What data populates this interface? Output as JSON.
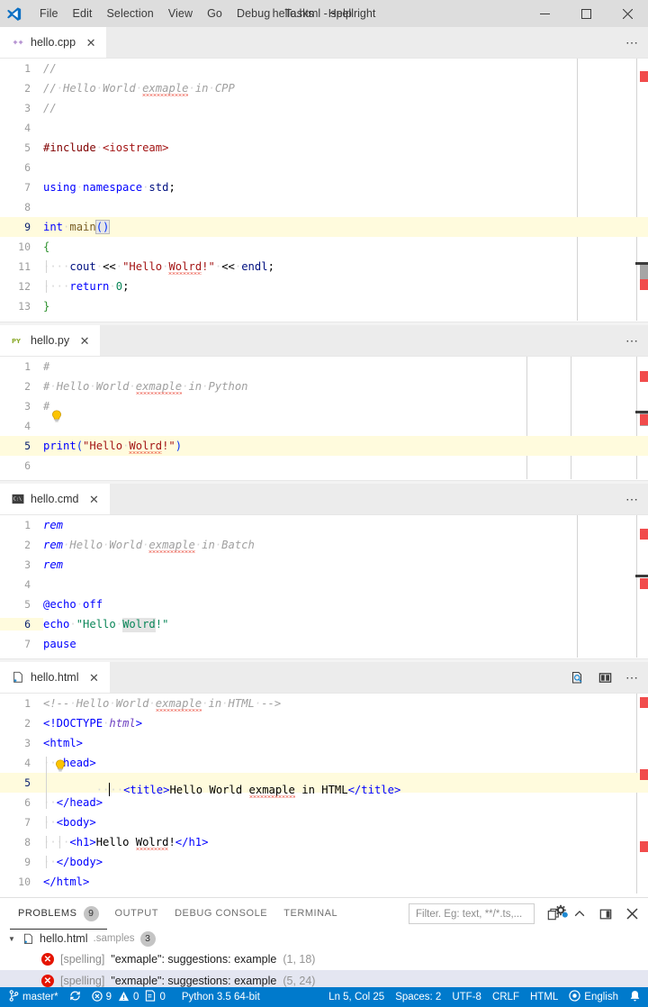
{
  "titlebar": {
    "logo_icon": "vscode-logo",
    "menus": [
      "File",
      "Edit",
      "Selection",
      "View",
      "Go",
      "Debug",
      "Tasks",
      "Help"
    ],
    "window_title": "hello.html - spellright",
    "minimize_icon": "minimize-icon",
    "maximize_icon": "maximize-icon",
    "close_icon": "close-icon"
  },
  "groups": [
    {
      "tab": {
        "label": "hello.cpp",
        "icon": "cpp-file-icon",
        "close_icon": "close-icon"
      },
      "actions": [
        {
          "icon": "more-actions-icon",
          "glyph": "⋯"
        }
      ],
      "current_line": 9,
      "lines": [
        {
          "n": 1,
          "text": "//"
        },
        {
          "n": 2,
          "text": "// Hello World exmaple in CPP"
        },
        {
          "n": 3,
          "text": "//"
        },
        {
          "n": 4,
          "text": ""
        },
        {
          "n": 5,
          "text": "#include <iostream>"
        },
        {
          "n": 6,
          "text": ""
        },
        {
          "n": 7,
          "text": "using namespace std;"
        },
        {
          "n": 8,
          "text": ""
        },
        {
          "n": 9,
          "text": "int main()"
        },
        {
          "n": 10,
          "text": "{"
        },
        {
          "n": 11,
          "text": "    cout << \"Hello Wolrd!\" << endl;"
        },
        {
          "n": 12,
          "text": "    return 0;"
        },
        {
          "n": 13,
          "text": "}"
        }
      ]
    },
    {
      "tab": {
        "label": "hello.py",
        "icon": "python-file-icon",
        "close_icon": "close-icon"
      },
      "actions": [
        {
          "icon": "more-actions-icon",
          "glyph": "⋯"
        }
      ],
      "current_line": 5,
      "lines": [
        {
          "n": 1,
          "text": "#"
        },
        {
          "n": 2,
          "text": "# Hello World exmaple in Python"
        },
        {
          "n": 3,
          "text": "#"
        },
        {
          "n": 4,
          "text": ""
        },
        {
          "n": 5,
          "text": "print(\"Hello Wolrd!\")"
        },
        {
          "n": 6,
          "text": ""
        }
      ]
    },
    {
      "tab": {
        "label": "hello.cmd",
        "icon": "batch-file-icon",
        "close_icon": "close-icon"
      },
      "actions": [
        {
          "icon": "more-actions-icon",
          "glyph": "⋯"
        }
      ],
      "current_line": 6,
      "lines": [
        {
          "n": 1,
          "text": "rem"
        },
        {
          "n": 2,
          "text": "rem Hello World exmaple in Batch"
        },
        {
          "n": 3,
          "text": "rem"
        },
        {
          "n": 4,
          "text": ""
        },
        {
          "n": 5,
          "text": "@echo off"
        },
        {
          "n": 6,
          "text": "echo \"Hello Wolrd!\""
        },
        {
          "n": 7,
          "text": "pause"
        }
      ]
    },
    {
      "tab": {
        "label": "hello.html",
        "icon": "html-file-icon",
        "close_icon": "close-icon"
      },
      "actions": [
        {
          "icon": "open-preview-icon",
          "glyph": ""
        },
        {
          "icon": "split-editor-icon",
          "glyph": ""
        },
        {
          "icon": "more-actions-icon",
          "glyph": "⋯"
        }
      ],
      "current_line": 5,
      "lines": [
        {
          "n": 1,
          "text": "<!-- Hello World exmaple in HTML -->"
        },
        {
          "n": 2,
          "text": "<!DOCTYPE html>"
        },
        {
          "n": 3,
          "text": "<html>"
        },
        {
          "n": 4,
          "text": "  <head>"
        },
        {
          "n": 5,
          "text": "    <title>Hello World exmaple in HTML</title>"
        },
        {
          "n": 6,
          "text": "  </head>"
        },
        {
          "n": 7,
          "text": "  <body>"
        },
        {
          "n": 8,
          "text": "    <h1>Hello Wolrd!</h1>"
        },
        {
          "n": 9,
          "text": "  </body>"
        },
        {
          "n": 10,
          "text": "</html>"
        }
      ]
    }
  ],
  "panel": {
    "tabs": [
      {
        "label": "Problems",
        "badge": "9",
        "active": true
      },
      {
        "label": "Output",
        "badge": "",
        "active": false
      },
      {
        "label": "Debug Console",
        "badge": "",
        "active": false
      },
      {
        "label": "Terminal",
        "badge": "",
        "active": false
      }
    ],
    "filter": {
      "value": "",
      "placeholder": "Filter. Eg: text, **/*.ts,..."
    },
    "filter_settings_icon": "filter-settings-gear-icon",
    "actions": [
      {
        "icon": "new-terminal-icon",
        "glyph": "⧉"
      },
      {
        "icon": "maximize-panel-icon",
        "glyph": "∧"
      },
      {
        "icon": "toggle-sidebar-icon",
        "glyph": "◧"
      },
      {
        "icon": "close-panel-icon",
        "glyph": "✕"
      }
    ],
    "group": {
      "twisty_icon": "chevron-down-icon",
      "file_icon": "html-file-icon",
      "file": "hello.html",
      "dir": ".samples",
      "count": "3"
    },
    "rows": [
      {
        "severity_icon": "error-icon",
        "tag": "[spelling]",
        "message": "\"exmaple\": suggestions: example",
        "position": "(1, 18)",
        "selected": false
      },
      {
        "severity_icon": "error-icon",
        "tag": "[spelling]",
        "message": "\"exmaple\": suggestions: example",
        "position": "(5, 24)",
        "selected": true
      }
    ]
  },
  "statusbar": {
    "branch_icon": "source-control-branch-icon",
    "branch": "master*",
    "sync_icon": "sync-icon",
    "errors_icon": "error-icon",
    "errors": "9",
    "warnings_icon": "warning-icon",
    "warnings": "0",
    "info_icon": "info-icon",
    "info": "0",
    "interpreter": "Python 3.5 64-bit",
    "cursor": "Ln 5, Col 25",
    "indent": "Spaces: 2",
    "encoding": "UTF-8",
    "eol": "CRLF",
    "language": "HTML",
    "spell_icon": "spellcheck-icon",
    "spell_language": "English",
    "bell_icon": "bell-icon"
  },
  "colors": {
    "accent": "#007acc",
    "error": "#e51400",
    "overview_marker": "#f14c4c",
    "current_line": "#fffbdd",
    "titlebar": "#dddddd",
    "tabbar": "#ececec"
  }
}
